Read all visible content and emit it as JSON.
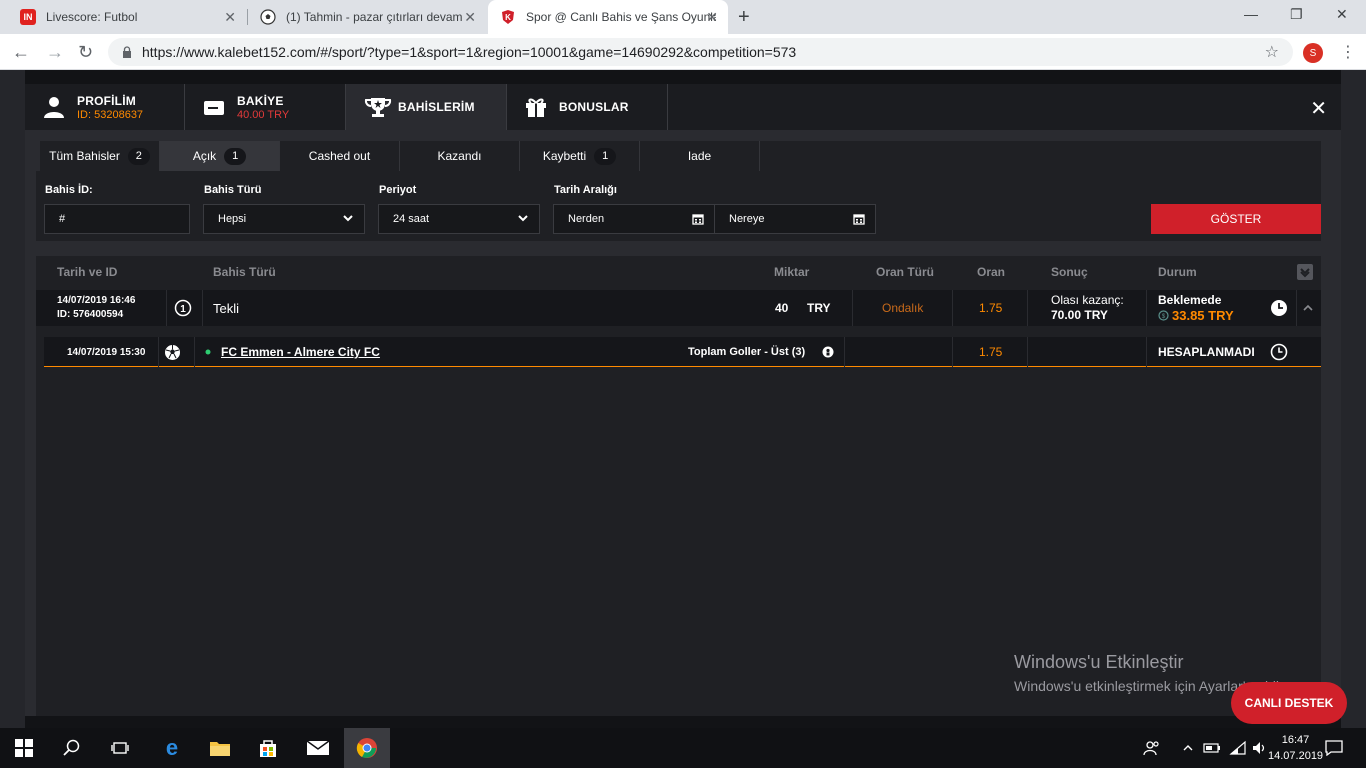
{
  "browser": {
    "tabs": [
      {
        "title": "Livescore: Futbol",
        "favicon": "IN"
      },
      {
        "title": "(1) Tahmin - pazar çıtırları devam",
        "favicon": "ball"
      },
      {
        "title": "Spor @ Canlı Bahis ve Şans Oyunları",
        "favicon": "shield"
      }
    ],
    "url": "https://www.kalebet152.com/#/sport/?type=1&sport=1&region=10001&game=14690292&competition=573",
    "profile_initial": "S"
  },
  "topnav": {
    "profile_label": "PROFİLİM",
    "profile_id": "ID: 53208637",
    "balance_label": "BAKİYE",
    "balance_value": "40.00 TRY",
    "bets_label": "BAHİSLERİM",
    "bonus_label": "BONUSLAR"
  },
  "filter_tabs": [
    {
      "label": "Tüm Bahisler",
      "count": "2"
    },
    {
      "label": "Açık",
      "count": "1"
    },
    {
      "label": "Cashed out",
      "count": ""
    },
    {
      "label": "Kazandı",
      "count": ""
    },
    {
      "label": "Kaybetti",
      "count": "1"
    },
    {
      "label": "Iade",
      "count": ""
    }
  ],
  "filters": {
    "bet_id_label": "Bahis İD:",
    "bet_id_value": "#",
    "bet_type_label": "Bahis Türü",
    "bet_type_value": "Hepsi",
    "period_label": "Periyot",
    "period_value": "24 saat",
    "date_range_label": "Tarih Aralığı",
    "from_value": "Nerden",
    "to_value": "Nereye",
    "show_button": "GÖSTER"
  },
  "table": {
    "headers": [
      "Tarih ve ID",
      "Bahis Türü",
      "Miktar",
      "Oran Türü",
      "Oran",
      "Sonuç",
      "Durum"
    ],
    "bet": {
      "datetime": "14/07/2019 16:46",
      "id": "ID: 576400594",
      "type_icon": "1",
      "type": "Tekli",
      "amount": "40",
      "currency": "TRY",
      "odds_type": "Ondalık",
      "odds": "1.75",
      "result_label": "Olası kazanç:",
      "result_value": "70.00 TRY",
      "status": "Beklemede",
      "cashout": "33.85 TRY"
    },
    "selection": {
      "datetime": "14/07/2019 15:30",
      "match": "FC Emmen - Almere City FC",
      "market": "Toplam Goller - Üst (3)",
      "odds": "1.75",
      "status": "HESAPLANMADI"
    }
  },
  "watermark": {
    "title": "Windows'u Etkinleştir",
    "subtitle": "Windows'u etkinleştirmek için Ayarlar'a gidin."
  },
  "live_help": "CANLI DESTEK",
  "taskbar": {
    "time": "16:47",
    "date": "14.07.2019"
  }
}
